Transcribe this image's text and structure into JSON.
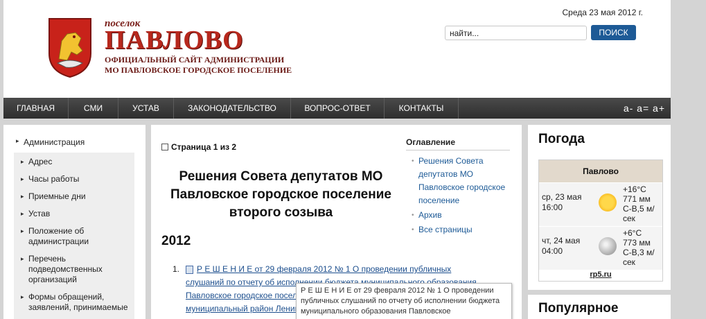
{
  "header": {
    "logo_small": "поселок",
    "logo_big": "ПАВЛОВО",
    "logo_line1": "ОФИЦИАЛЬНЫЙ САЙТ АДМИНИСТРАЦИИ",
    "logo_line2": "МО ПАВЛОВСКОЕ ГОРОДСКОЕ ПОСЕЛЕНИЕ",
    "date": "Среда 23 мая 2012 г.",
    "search_value": "найти...",
    "search_button": "ПОИСК"
  },
  "nav": {
    "items": [
      "ГЛАВНАЯ",
      "СМИ",
      "УСТАВ",
      "ЗАКОНОДАТЕЛЬСТВО",
      "ВОПРОС-ОТВЕТ",
      "КОНТАКТЫ"
    ],
    "font_controls": "a- a= a+"
  },
  "sidebar": {
    "top_item": "Администрация",
    "items": [
      "Адрес",
      "Часы работы",
      "Приемные дни",
      "Устав",
      "Положение об администрации",
      "Перечень подведомственных организаций",
      "Формы обращений, заявлений, принимаемые"
    ]
  },
  "article": {
    "page_indicator": "Страница 1 из 2",
    "title": "Решения Совета депутатов МО Павловское городское поселение второго созыва",
    "year": "2012",
    "list_number": "1.",
    "link_lines": [
      "Р Е Ш Е Н И Е от 29 февраля 2012 № 1 О проведении публичных",
      "слушаний по отчету об исполнении бюджета муниципального образования",
      "Павловское городское поселение Кировского",
      "муниципальный район Ленинградской"
    ]
  },
  "toc": {
    "title": "Оглавление",
    "items": [
      "Решения Совета депутатов МО Павловское городское поселение",
      "Архив",
      "Все страницы"
    ]
  },
  "tooltip": {
    "text": "Р Е Ш Е Н И Е   от 29 февраля 2012 № 1    О проведении публичных слушаний по отчету об исполнении бюджета  муниципального образования Павловское"
  },
  "weather": {
    "title": "Погода",
    "city": "Павлово",
    "rows": [
      {
        "date": "ср, 23 мая 16:00",
        "icon": "sun-icon",
        "temp": "+16°C",
        "pressure": "771 мм",
        "wind": "С-В,5 м/сек"
      },
      {
        "date": "чт, 24 мая 04:00",
        "icon": "moon-icon",
        "temp": "+6°C",
        "pressure": "773 мм",
        "wind": "С-В,3 м/сек"
      }
    ],
    "source": "rp5.ru"
  },
  "popular": {
    "title": "Популярное"
  },
  "colors": {
    "brand_red": "#b7281d",
    "link_blue": "#1d4f8e",
    "nav_dark": "#333333",
    "button_blue": "#1d5a96"
  }
}
